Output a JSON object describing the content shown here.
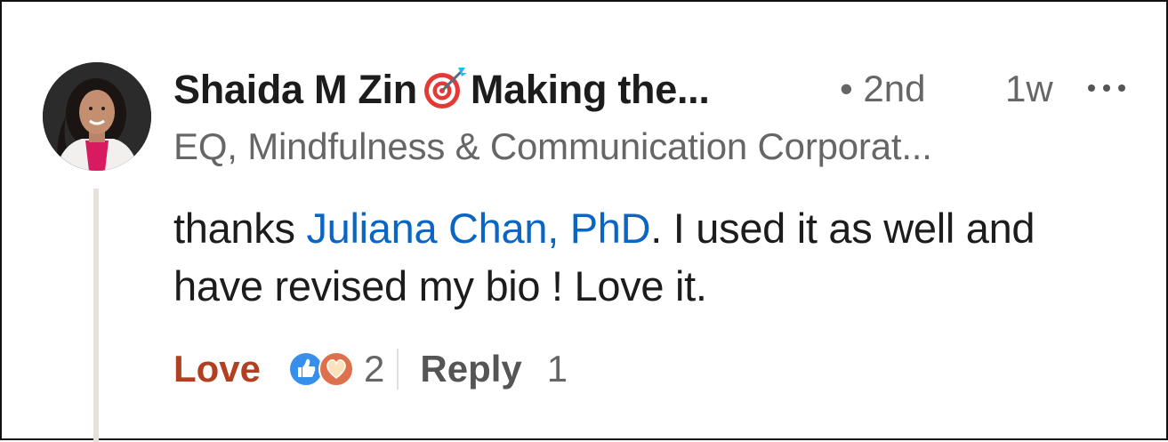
{
  "comment": {
    "author_name": "Shaida M Zin",
    "author_tagline": "Making the...",
    "name_emoji_icon": "direct-hit-target-icon",
    "connection_degree": "• 2nd",
    "timestamp": "1w",
    "more_icon": "more-horizontal-icon",
    "headline": "EQ, Mindfulness & Communication Corporat...",
    "body": {
      "prefix": "thanks ",
      "mention": "Juliana Chan, PhD",
      "suffix": ". I used it as well and have revised my bio ! Love it."
    },
    "actions": {
      "love_label": "Love",
      "reaction_icons": [
        "like-icon",
        "love-icon"
      ],
      "reaction_count": "2",
      "reply_label": "Reply",
      "reply_count": "1"
    }
  },
  "colors": {
    "mention": "#0a66c2",
    "love_active": "#b24020",
    "like_blue": "#378fe9",
    "love_orange": "#df704d",
    "thread_line": "#e6e1da"
  }
}
